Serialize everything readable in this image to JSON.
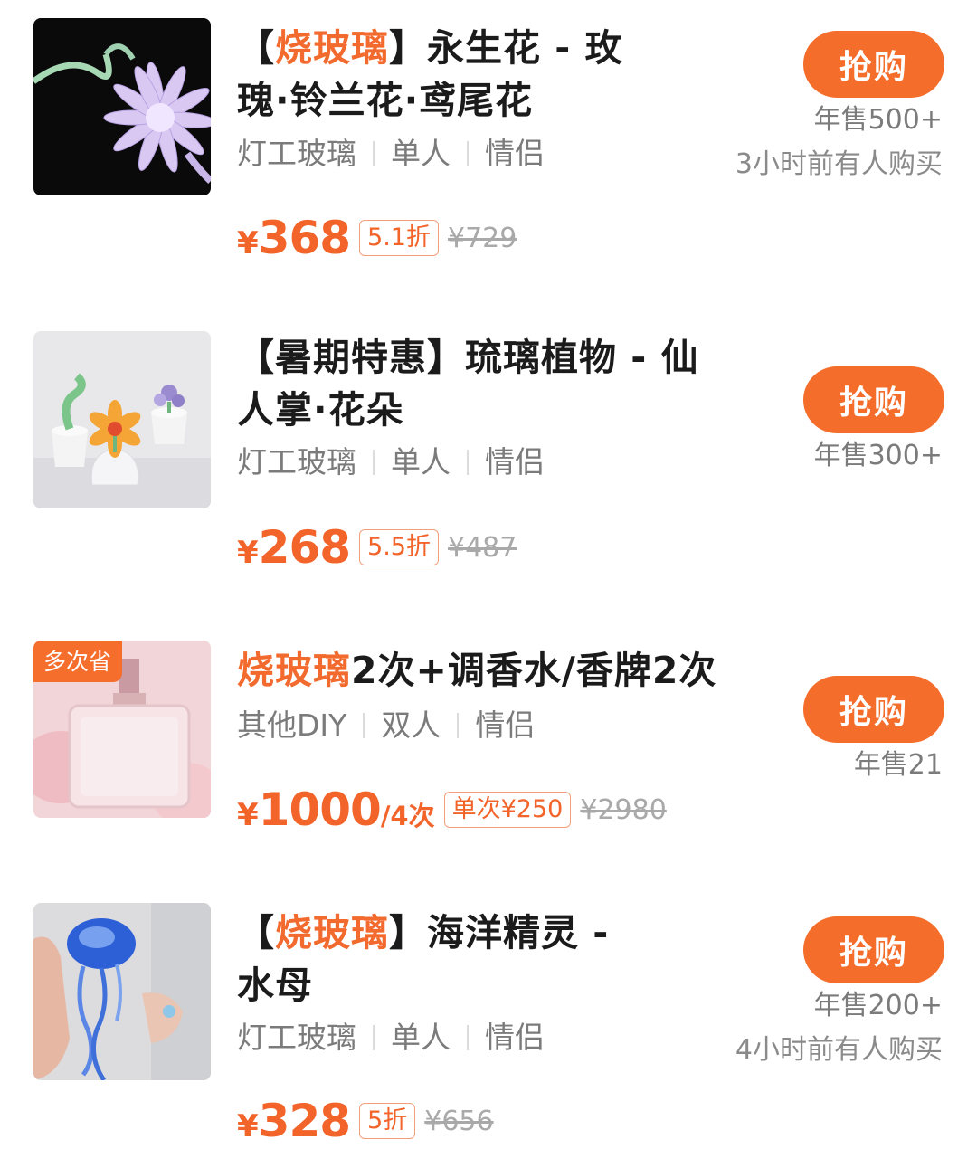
{
  "products": [
    {
      "title_bracket_open": "【",
      "title_highlight": "烧玻璃",
      "title_line1_rest": "】永生花 - 玫",
      "title_line2": "瑰·铃兰花·鸢尾花",
      "tags": [
        "灯工玻璃",
        "单人",
        "情侣"
      ],
      "price_currency": "¥",
      "price": "368",
      "discount": "5.1折",
      "original_price": "¥729",
      "buy_label": "抢购",
      "sales": "年售500+",
      "recent": "3小时前有人购买"
    },
    {
      "title_line1": "【暑期特惠】琉璃植物 - 仙",
      "title_line2": "人掌·花朵",
      "tags": [
        "灯工玻璃",
        "单人",
        "情侣"
      ],
      "price_currency": "¥",
      "price": "268",
      "discount": "5.5折",
      "original_price": "¥487",
      "buy_label": "抢购",
      "sales": "年售300+"
    },
    {
      "corner_badge": "多次省",
      "title_highlight": "烧玻璃",
      "title_rest": "2次+调香水/香牌2次",
      "tags": [
        "其他DIY",
        "双人",
        "情侣"
      ],
      "price_currency": "¥",
      "price": "1000",
      "price_unit": "/4次",
      "discount": "单次¥250",
      "original_price": "¥2980",
      "buy_label": "抢购",
      "sales": "年售21"
    },
    {
      "title_bracket_open": "【",
      "title_highlight": "烧玻璃",
      "title_line1_rest": "】海洋精灵 -",
      "title_line2": "水母",
      "tags": [
        "灯工玻璃",
        "单人",
        "情侣"
      ],
      "price_currency": "¥",
      "price": "328",
      "discount": "5折",
      "original_price": "¥656",
      "buy_label": "抢购",
      "sales": "年售200+",
      "recent": "4小时前有人购买"
    }
  ]
}
